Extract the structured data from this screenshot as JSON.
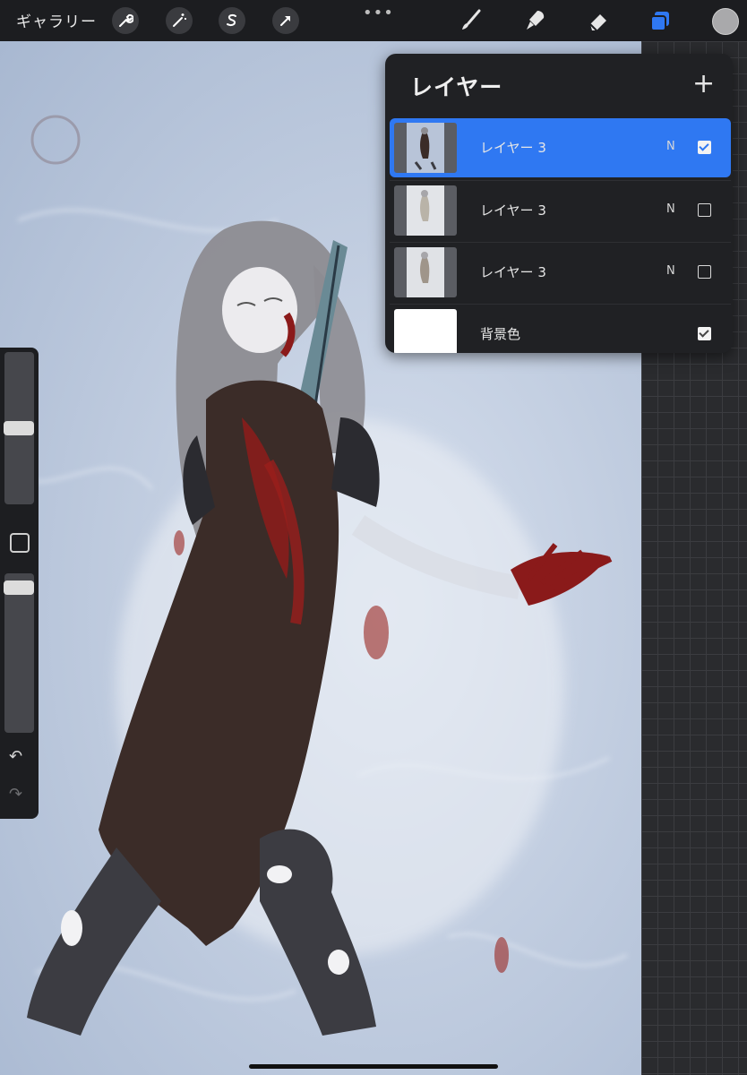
{
  "topbar": {
    "gallery_label": "ギャラリー",
    "more_label": "•••",
    "tools_left": [
      "wrench-icon",
      "magic-wand-icon",
      "selection-s-icon",
      "transform-arrow-icon"
    ],
    "tools_right": [
      "brush-icon",
      "smudge-icon",
      "eraser-icon",
      "layers-icon"
    ],
    "accent_color": "#2f78f2",
    "current_color": "#a9a9ab"
  },
  "sidebar": {
    "brush_size_level": 0.52,
    "opacity_level": 0.0,
    "undo_glyph": "↶",
    "redo_glyph": "↷"
  },
  "layers_panel": {
    "title": "レイヤー",
    "add_label": "+",
    "layers": [
      {
        "name": "レイヤー 3",
        "mode": "N",
        "visible": true,
        "active": true
      },
      {
        "name": "レイヤー 3",
        "mode": "N",
        "visible": false,
        "active": false
      },
      {
        "name": "レイヤー 3",
        "mode": "N",
        "visible": false,
        "active": false
      },
      {
        "name": "背景色",
        "mode": "",
        "visible": true,
        "active": false
      }
    ]
  }
}
